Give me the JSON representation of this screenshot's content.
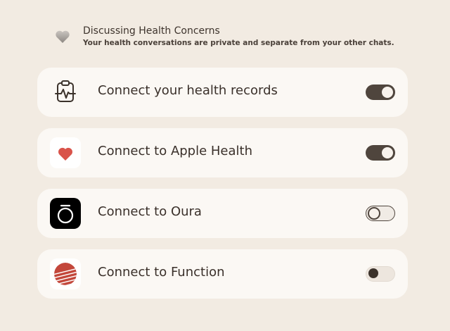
{
  "header": {
    "title": "Discussing Health Concerns",
    "subtitle": "Your health conversations are private and separate from your other chats."
  },
  "connections": [
    {
      "label": "Connect your health records",
      "icon": "health-records-icon",
      "enabled": true
    },
    {
      "label": "Connect to Apple Health",
      "icon": "apple-health-heart-icon",
      "enabled": true
    },
    {
      "label": "Connect to Oura",
      "icon": "oura-logo-icon",
      "enabled": false
    },
    {
      "label": "Connect to Function",
      "icon": "function-logo-icon",
      "enabled": false
    }
  ],
  "colors": {
    "background": "#f2ebe2",
    "card": "#fbf8f4",
    "toggle_on": "#4f453d",
    "toggle_off": "#ede6de",
    "apple_heart": "#d9534a",
    "function_logo": "#c3473b"
  }
}
